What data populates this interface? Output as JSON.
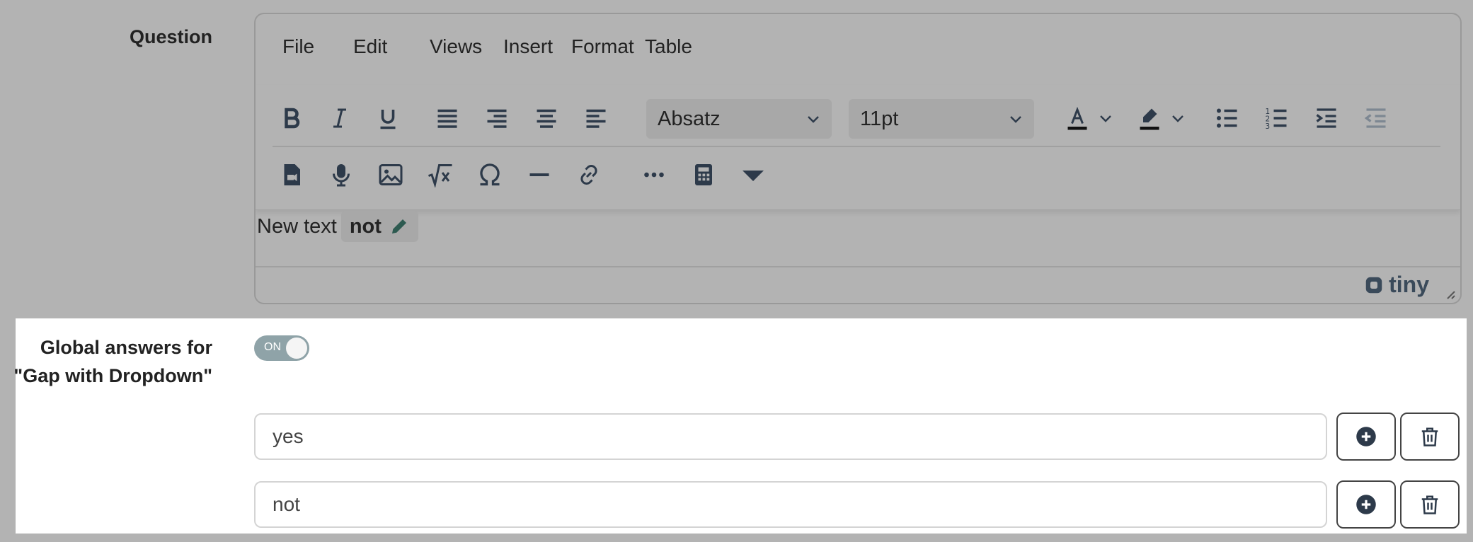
{
  "labels": {
    "question": "Question",
    "global_line1": "Global answers for",
    "global_line2": "\"Gap with Dropdown\""
  },
  "editor": {
    "menu": [
      "File",
      "Edit",
      "Views",
      "Insert",
      "Format",
      "Table"
    ],
    "block_format": "Absatz",
    "font_size": "11pt",
    "content_text": "New text",
    "gap_chip": "not",
    "brand": "tiny"
  },
  "toggle": {
    "label": "ON",
    "state": "on"
  },
  "answers": [
    {
      "value": "yes"
    },
    {
      "value": "not"
    }
  ],
  "icons": {
    "row1": [
      "bold-icon",
      "italic-icon",
      "underline-icon",
      "align-justify-icon",
      "align-right-icon",
      "align-center-icon",
      "align-left-icon",
      "text-color-icon",
      "highlight-color-icon",
      "bullet-list-icon",
      "numbered-list-icon",
      "indent-icon",
      "outdent-icon"
    ],
    "row2": [
      "media-file-icon",
      "microphone-icon",
      "image-icon",
      "formula-icon",
      "omega-icon",
      "horizontal-rule-icon",
      "link-icon",
      "more-icon",
      "calculator-icon",
      "dropdown-gap-icon"
    ]
  },
  "colors": {
    "accent_dark": "#2d3a4a",
    "toggle_on": "#8fa3a8",
    "backdrop": "#b3b3b3"
  }
}
